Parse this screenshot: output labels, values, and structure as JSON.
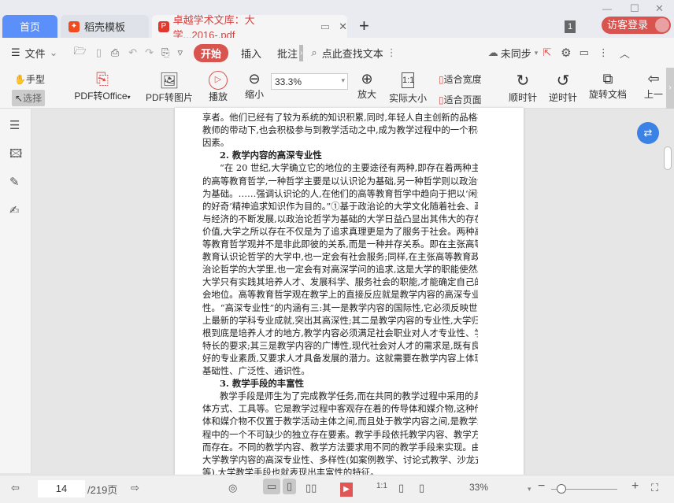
{
  "tabs": {
    "home": "首页",
    "template": "稻壳模板",
    "doc": "卓越学术文库：大学...2016-.pdf",
    "add": "+"
  },
  "window": {
    "badge": "1",
    "login": "访客登录",
    "minimize": "—",
    "maximize": "☐",
    "close": "✕"
  },
  "toolbar1": {
    "menu": "文件",
    "start": "开始",
    "insert": "插入",
    "annotate": "批注",
    "search": "点此查找文本",
    "sync": "未同步"
  },
  "toolbar2": {
    "hand": "手型",
    "select": "选择",
    "pdf_office": "PDF转Office",
    "pdf_image": "PDF转图片",
    "play": "播放",
    "zoom_out": "缩小",
    "zoom_value": "33.3%",
    "zoom_in": "放大",
    "actual": "实际大小",
    "fit_width": "适合宽度",
    "fit_page": "适合页面",
    "cw": "顺时针",
    "ccw": "逆时针",
    "rotate": "旋转文档",
    "prev": "上一"
  },
  "document": {
    "lines": [
      "享者。他们已经有了较为系统的知识积累,同时,年轻人自主创新的品格在",
      "教师的带动下,也会积极参与到教学活动之中,成为教学过程中的一个积极",
      "因素。",
      "2. 教学内容的高深专业性",
      "“在 20 世纪,大学确立它的地位的主要途径有两种,即存在着两种主要",
      "的高等教育哲学,一种哲学主要是以认识论为基础,另一种哲学则以政治论",
      "为基础。……强调认识论的人,在他们的高等教育哲学中趋向于把以‘闲逸",
      "的好奇’精神追求知识作为目的。”①基于政治论的大学文化随着社会、政治",
      "与经济的不断发展,以政治论哲学为基础的大学日益凸显出其伟大的存在",
      "价值,大学之所以存在不仅是为了追求真理更是为了服务于社会。两种高",
      "等教育哲学观并不是非此即彼的关系,而是一种并存关系。即在主张高等",
      "教育认识论哲学的大学中,也一定会有社会服务;同样,在主张高等教育政",
      "治论哲学的大学里,也一定会有对高深学问的追求,这是大学的职能使然。",
      "大学只有实践其培养人才、发展科学、服务社会的职能,才能确定自己的社",
      "会地位。高等教育哲学观在教学上的直接反应就是教学内容的高深专业",
      "性。“高深专业性”的内涵有三:其一是教学内容的国际性,它必须反映世界",
      "上最新的学科专业成就,突出其高深性;其二是教学内容的专业性,大学归",
      "根到底是培养人才的地方,教学内容必须满足社会职业对人才专业性、学科",
      "特长的要求;其三是教学内容的广博性,现代社会对人才的需求是,既有良",
      "好的专业素质,又要求人才具备发展的潜力。这就需要在教学内容上体现",
      "基础性、广泛性、通识性。",
      "3. 教学手段的丰富性",
      "教学手段是师生为了完成教学任务,而在共同的教学过程中采用的具",
      "体方式、工具等。它是教学过程中客观存在着的传导体和媒介物,这种传导",
      "体和媒介物不仅置于教学活动主体之间,而且处于教学内容之间,是教学过",
      "程中的一个不可缺少的独立存在要素。教学手段依托教学内容、教学方法",
      "而存在。不同的教学内容、教学方法要求用不同的教学手段来实现。由于",
      "大学教学内容的高深专业性、多样性(如案例教学、讨论式教学、沙龙式教学",
      "等),大学教学手段也就表现出丰富性的特征。"
    ]
  },
  "status": {
    "page": "14",
    "total": "/219页",
    "zoom": "33%"
  },
  "colors": {
    "accent": "#d9534f",
    "home_tab": "#5b8ff9"
  }
}
